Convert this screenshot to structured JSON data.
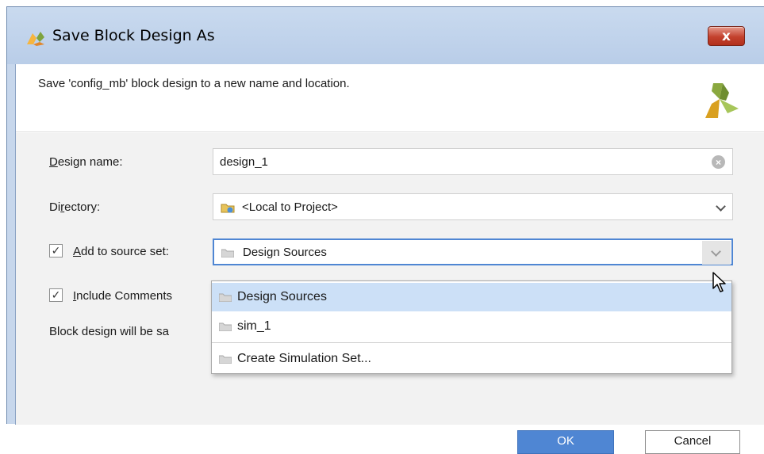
{
  "window": {
    "title": "Save Block Design As",
    "close_label": "x"
  },
  "header": {
    "description": "Save 'config_mb' block design to a new name and location."
  },
  "form": {
    "design_name_label_u": "D",
    "design_name_label_rest": "esign name:",
    "design_name_value": "design_1",
    "directory_label_a": "Di",
    "directory_label_u": "r",
    "directory_label_rest": "ectory:",
    "directory_value": "<Local to Project>",
    "add_source_set_label_u": "A",
    "add_source_set_label_rest": "dd to source set:",
    "add_source_set_checked": true,
    "source_set_value": "Design Sources",
    "include_comments_label_u": "I",
    "include_comments_label_rest": "nclude Comments",
    "include_comments_checked": true,
    "save_note": "Block design will be sa"
  },
  "dropdown": {
    "options": [
      "Design Sources",
      "sim_1",
      "Create Simulation Set..."
    ],
    "selected_index": 0
  },
  "buttons": {
    "ok": "OK",
    "cancel": "Cancel"
  },
  "icons": {
    "title_logo": "xilinx-logo-icon",
    "header_logo": "xilinx-logo-icon",
    "clear": "clear-icon",
    "folder": "folder-icon",
    "project_folder": "project-folder-icon"
  },
  "colors": {
    "accent": "#4f86d3",
    "selected_row": "#cce0f7",
    "close": "#c3412d"
  }
}
